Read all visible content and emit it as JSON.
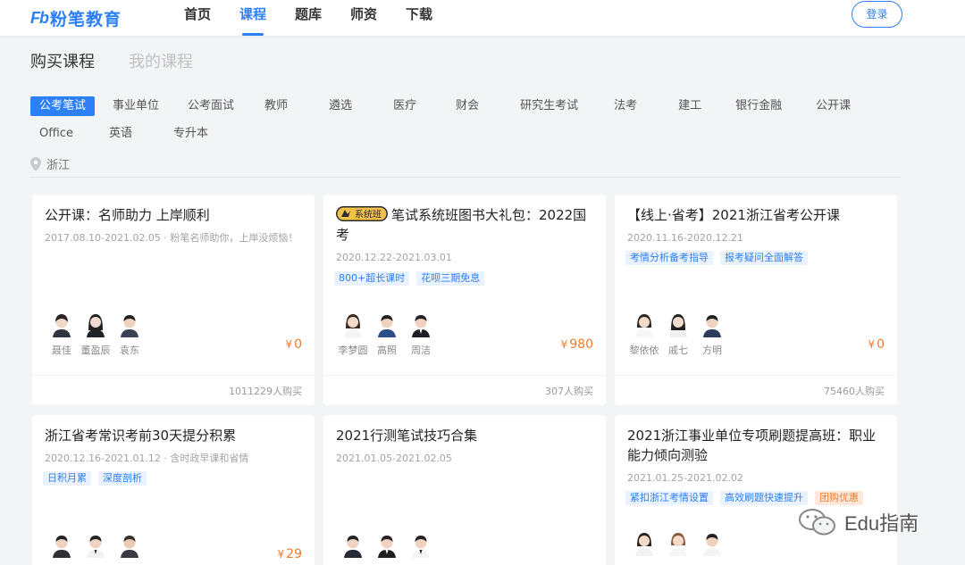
{
  "brand": {
    "mark": "Fb",
    "name": "粉笔教育"
  },
  "nav": [
    {
      "label": "首页",
      "active": false
    },
    {
      "label": "课程",
      "active": true
    },
    {
      "label": "题库",
      "active": false
    },
    {
      "label": "师资",
      "active": false
    },
    {
      "label": "下载",
      "active": false
    }
  ],
  "login_label": "登录",
  "section_tabs": [
    {
      "label": "购买课程",
      "active": true
    },
    {
      "label": "我的课程",
      "active": false
    }
  ],
  "categories_row1": [
    "公考笔试",
    "事业单位",
    "公考面试",
    "教师",
    "遴选",
    "医疗",
    "财会",
    "研究生考试",
    "法考",
    "建工",
    "银行金融",
    "公开课"
  ],
  "categories_row2": [
    "Office",
    "英语",
    "专升本"
  ],
  "active_category": "公考笔试",
  "location": "浙江",
  "cards": [
    {
      "title": "公开课：名师助力 上岸顺利",
      "badge": "",
      "date": "2017.08.10-2021.02.05 · 粉笔名师助你，上岸没烦恼！",
      "tags": [],
      "teachers": [
        "聂佳",
        "董盈辰",
        "袁东"
      ],
      "price": "0",
      "buyers": "1011229人购买"
    },
    {
      "title": "笔试系统班图书大礼包：2022国考",
      "badge": "系统班",
      "date": "2020.12.22-2021.03.01",
      "tags": [
        {
          "label": "800+超长课时"
        },
        {
          "label": "花呗三期免息"
        }
      ],
      "teachers": [
        "李梦圆",
        "高照",
        "周洁"
      ],
      "price": "980",
      "buyers": "307人购买"
    },
    {
      "title": "【线上·省考】2021浙江省考公开课",
      "badge": "",
      "date": "2020.11.16-2020.12.21",
      "tags": [
        {
          "label": "考情分析备考指导"
        },
        {
          "label": "报考疑问全面解答"
        }
      ],
      "teachers": [
        "黎依依",
        "戚七",
        "方明"
      ],
      "price": "0",
      "buyers": "75460人购买"
    },
    {
      "title": "浙江省考常识考前30天提分积累",
      "badge": "",
      "date": "2020.12.16-2021.01.12 · 含时政早课和省情",
      "tags": [
        {
          "label": "日积月累"
        },
        {
          "label": "深度剖析"
        }
      ],
      "teachers": [
        "",
        "",
        ""
      ],
      "price": "29",
      "buyers": ""
    },
    {
      "title": "2021行测笔试技巧合集",
      "badge": "",
      "date": "2021.01.05-2021.02.05",
      "tags": [],
      "teachers": [
        "",
        "",
        ""
      ],
      "price": "",
      "buyers": ""
    },
    {
      "title": "2021浙江事业单位专项刷题提高班：职业能力倾向测验",
      "badge": "",
      "date": "2021.01.25-2021.02.02",
      "tags": [
        {
          "label": "紧扣浙江考情设置"
        },
        {
          "label": "高效刷题快速提升"
        },
        {
          "label": "团购优惠",
          "orange": true
        }
      ],
      "teachers": [
        "",
        "",
        ""
      ],
      "price": "",
      "buyers": ""
    }
  ],
  "currency": "¥",
  "watermark": "Edu指南",
  "colors": {
    "accent": "#2c7ff5",
    "price": "#f07c2d",
    "page_bg": "#f3f4f6"
  }
}
